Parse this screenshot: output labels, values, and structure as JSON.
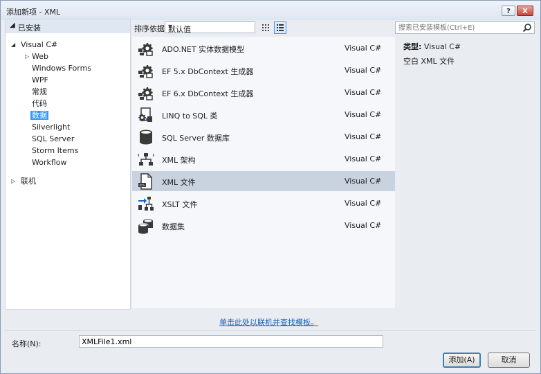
{
  "window": {
    "title": "添加新项 - XML",
    "help_label": "?",
    "close_label": "X"
  },
  "tree": {
    "installed_label": "已安装",
    "visual_csharp": "Visual C#",
    "children": [
      "Web",
      "Windows Forms",
      "WPF",
      "常规",
      "代码",
      "数据",
      "Silverlight",
      "SQL Server",
      "Storm Items",
      "Workflow"
    ],
    "selected_index": 5,
    "online_label": "联机"
  },
  "toolbar": {
    "sort_label": "排序依据:",
    "sort_value": "默认值"
  },
  "search": {
    "placeholder": "搜索已安装模板(Ctrl+E)"
  },
  "items": [
    {
      "name": "ADO.NET 实体数据模型",
      "type": "Visual C#",
      "icon": "ado-entity-icon"
    },
    {
      "name": "EF 5.x DbContext 生成器",
      "type": "Visual C#",
      "icon": "ef5-generator-icon"
    },
    {
      "name": "EF 6.x DbContext 生成器",
      "type": "Visual C#",
      "icon": "ef6-generator-icon"
    },
    {
      "name": "LINQ to SQL 类",
      "type": "Visual C#",
      "icon": "linq-sql-icon"
    },
    {
      "name": "SQL Server 数据库",
      "type": "Visual C#",
      "icon": "database-icon"
    },
    {
      "name": "XML 架构",
      "type": "Visual C#",
      "icon": "xml-schema-icon"
    },
    {
      "name": "XML 文件",
      "type": "Visual C#",
      "icon": "xml-file-icon"
    },
    {
      "name": "XSLT 文件",
      "type": "Visual C#",
      "icon": "xslt-icon"
    },
    {
      "name": "数据集",
      "type": "Visual C#",
      "icon": "dataset-icon"
    }
  ],
  "selected_item_index": 6,
  "details": {
    "type_label": "类型:",
    "type_value": "Visual C#",
    "description": "空白 XML 文件"
  },
  "online_link": "单击此处以联机并查找模板。",
  "name_field": {
    "label": "名称(N):",
    "value": "XMLFile1.xml"
  },
  "buttons": {
    "add": "添加(A)",
    "cancel": "取消"
  }
}
